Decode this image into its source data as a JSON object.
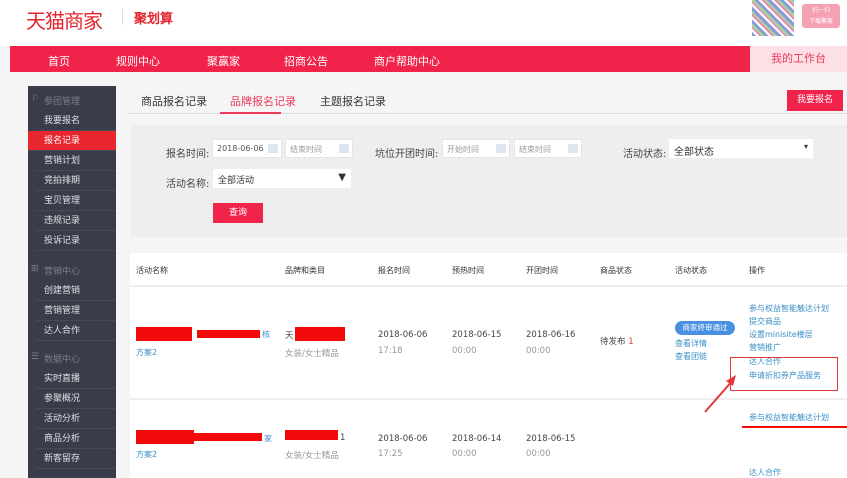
{
  "header": {
    "logo": "天猫商家",
    "logo_sub": "聚划算",
    "qr_badge": [
      "扫一扫",
      "下载聚客"
    ]
  },
  "nav": {
    "items": [
      "首页",
      "规则中心",
      "聚赢家",
      "招商公告",
      "商户帮助中心"
    ],
    "workspace": "我的工作台"
  },
  "sidebar": {
    "groups": [
      {
        "title": "参团管理",
        "icon": "flag-icon",
        "items": [
          "我要报名",
          "报名记录",
          "营销计划",
          "竞拍排期",
          "宝贝管理",
          "违规记录",
          "投诉记录"
        ]
      },
      {
        "title": "营销中心",
        "icon": "gift-icon",
        "items": [
          "创建营销",
          "营销管理",
          "达人合作"
        ]
      },
      {
        "title": "数据中心",
        "icon": "list-icon",
        "items": [
          "实时直播",
          "参聚概况",
          "活动分析",
          "商品分析",
          "新客留存"
        ]
      }
    ],
    "active": "报名记录"
  },
  "tabs": {
    "items": [
      "商品报名记录",
      "品牌报名记录",
      "主题报名记录"
    ],
    "active": "品牌报名记录",
    "signup_button": "我要报名"
  },
  "filter": {
    "reg_time_label": "报名时间:",
    "reg_start": "2018-06-06",
    "reg_end_placeholder": "结束时间",
    "slot_time_label": "坑位开团时间:",
    "slot_start_placeholder": "开始时间",
    "slot_end_placeholder": "结束时间",
    "status_label": "活动状态:",
    "status_value": "全部状态",
    "name_label": "活动名称:",
    "name_value": "全部活动",
    "query_button": "查询"
  },
  "table": {
    "headers": [
      "活动名称",
      "品牌和类目",
      "报名时间",
      "预热时间",
      "开团时间",
      "商品状态",
      "活动状态",
      "操作"
    ],
    "rows": [
      {
        "name_suffix": "核",
        "plan": "方案2",
        "brand_prefix": "天",
        "category": "女装/女士精品",
        "reg_date": "2018-06-06",
        "reg_time": "17:18",
        "pre_date": "2018-06-15",
        "pre_time": "00:00",
        "open_date": "2018-06-16",
        "open_time": "00:00",
        "product_status": "待发布",
        "product_count": "1",
        "activity_status": "商家终审通过",
        "status_links": [
          "查看详情",
          "查看团链"
        ],
        "ops": [
          "参与权益智能触达计划",
          "提交商品",
          "设置minisite楼层",
          "营销推广",
          "达人合作",
          "申请折扣券产品服务"
        ]
      },
      {
        "name_suffix": "家",
        "plan": "方案2",
        "brand_suffix": "1",
        "category": "女装/女士精品",
        "reg_date": "2018-06-06",
        "reg_time": "17:25",
        "pre_date": "2018-06-14",
        "pre_time": "00:00",
        "open_date": "2018-06-15",
        "open_time": "00:00",
        "ops": [
          "参与权益智能触达计划",
          "达人合作"
        ]
      }
    ]
  },
  "colors": {
    "brand_red": "#f0244a",
    "sidebar_bg": "#393d4a",
    "link": "#3a8fc7",
    "annotation": "#e23a3a"
  }
}
